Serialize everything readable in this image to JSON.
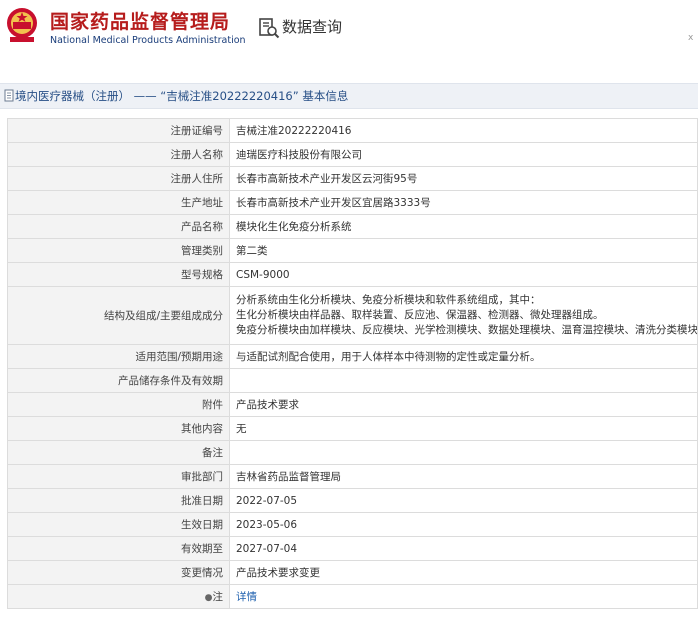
{
  "header": {
    "cn_title": "国家药品监督管理局",
    "en_title": "National Medical Products Administration",
    "query_label": "数据查询",
    "emblem_icon": "national-emblem-icon",
    "query_icon": "document-search-icon",
    "brand_color": "#b61c1c"
  },
  "breadcrumb": {
    "text": "境内医疗器械（注册） —— “吉械注准20222220416” 基本信息"
  },
  "rows": [
    {
      "label": "注册证编号",
      "value": "吉械注准20222220416"
    },
    {
      "label": "注册人名称",
      "value": "迪瑞医疗科技股份有限公司"
    },
    {
      "label": "注册人住所",
      "value": "长春市高新技术产业开发区云河街95号"
    },
    {
      "label": "生产地址",
      "value": "长春市高新技术产业开发区宜居路3333号"
    },
    {
      "label": "产品名称",
      "value": "模块化生化免疫分析系统"
    },
    {
      "label": "管理类别",
      "value": "第二类"
    },
    {
      "label": "型号规格",
      "value": "CSM-9000"
    },
    {
      "label": "结构及组成/主要组成成分",
      "lines": [
        "分析系统由生化分析模块、免疫分析模块和软件系统组成，其中：",
        "生化分析模块由样品器、取样装置、反应池、保温器、检测器、微处理器组成。",
        "免疫分析模块由加样模块、反应模块、光学检测模块、数据处理模块、温育温控模块、清洗分类模块组成。"
      ]
    },
    {
      "label": "适用范围/预期用途",
      "value": "与适配试剂配合使用，用于人体样本中待测物的定性或定量分析。"
    },
    {
      "label": "产品储存条件及有效期",
      "value": ""
    },
    {
      "label": "附件",
      "value": "产品技术要求"
    },
    {
      "label": "其他内容",
      "value": "无"
    },
    {
      "label": "备注",
      "value": ""
    },
    {
      "label": "审批部门",
      "value": "吉林省药品监督管理局"
    },
    {
      "label": "批准日期",
      "value": "2022-07-05"
    },
    {
      "label": "生效日期",
      "value": "2023-05-06"
    },
    {
      "label": "有效期至",
      "value": "2027-07-04"
    },
    {
      "label": "变更情况",
      "value": "产品技术要求变更"
    },
    {
      "label": "注",
      "value": "详情",
      "pin": "●"
    }
  ]
}
